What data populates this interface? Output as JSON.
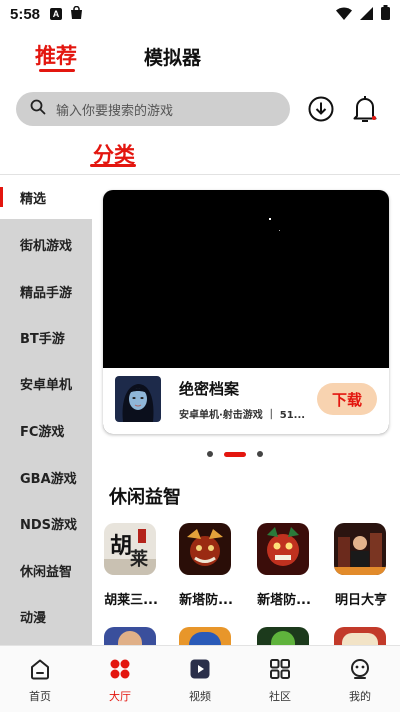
{
  "status_bar": {
    "time": "5:58",
    "notif_letter": "A"
  },
  "top_tabs": [
    {
      "label": "推荐",
      "active": true
    },
    {
      "label": "模拟器",
      "active": false
    }
  ],
  "search": {
    "placeholder": "输入你要搜索的游戏"
  },
  "icons": {
    "search": "search-icon",
    "download": "download-icon",
    "bell": "bell-icon"
  },
  "section": {
    "title": "分类"
  },
  "sidebar": {
    "items": [
      {
        "label": "精选",
        "active": true
      },
      {
        "label": "街机游戏"
      },
      {
        "label": "精品手游"
      },
      {
        "label": "BT手游"
      },
      {
        "label": "安卓单机"
      },
      {
        "label": "FC游戏"
      },
      {
        "label": "GBA游戏"
      },
      {
        "label": "NDS游戏"
      },
      {
        "label": "休闲益智"
      },
      {
        "label": "动漫"
      }
    ]
  },
  "banner": {
    "title": "绝密档案",
    "subtitle": "安卓单机·射击游戏 ｜ 51...",
    "button": "下载"
  },
  "carousel": {
    "count": 3,
    "active_index": 1
  },
  "category": {
    "title": "休闲益智",
    "games": [
      {
        "name": "胡莱三..."
      },
      {
        "name": "新塔防..."
      },
      {
        "name": "新塔防..."
      },
      {
        "name": "明日大亨"
      }
    ]
  },
  "bottom_nav": [
    {
      "label": "首页",
      "icon": "home-icon",
      "active": false
    },
    {
      "label": "大厅",
      "icon": "lobby-icon",
      "active": true
    },
    {
      "label": "视频",
      "icon": "video-icon",
      "active": false
    },
    {
      "label": "社区",
      "icon": "community-icon",
      "active": false
    },
    {
      "label": "我的",
      "icon": "profile-icon",
      "active": false
    }
  ],
  "colors": {
    "accent": "#e3160f",
    "sidebar_bg": "#d4d4d4",
    "search_bg": "#cfcfcf",
    "download_btn_bg": "#f8d3b0"
  }
}
